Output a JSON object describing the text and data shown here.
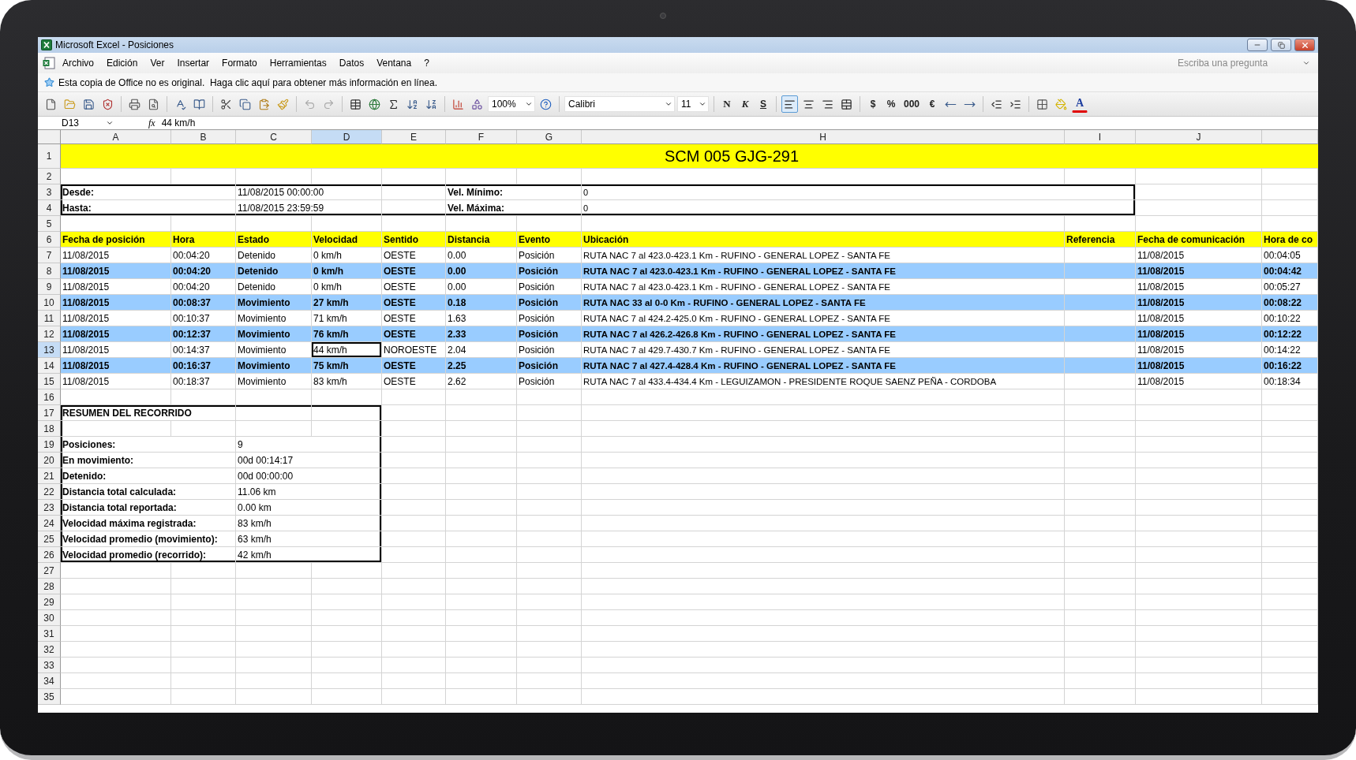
{
  "window": {
    "title": "Microsoft Excel - Posiciones"
  },
  "menu": [
    {
      "label": "Archivo"
    },
    {
      "label": "Edición"
    },
    {
      "label": "Ver"
    },
    {
      "label": "Insertar"
    },
    {
      "label": "Formato"
    },
    {
      "label": "Herramientas"
    },
    {
      "label": "Datos"
    },
    {
      "label": "Ventana"
    },
    {
      "label": "?"
    }
  ],
  "help_search": {
    "placeholder": "Escriba una pregunta"
  },
  "info_bar": {
    "text": "Esta copia de Office no es original.  Haga clic aquí para obtener más información en línea."
  },
  "toolbar": {
    "zoom": "100%",
    "font": "Calibri",
    "size": "11",
    "format_buttons": [
      {
        "label": "N",
        "kind": "bold"
      },
      {
        "label": "K",
        "kind": "italic"
      },
      {
        "label": "S",
        "kind": "underline"
      }
    ],
    "alignment": [
      {
        "kind": "left",
        "selected": true
      },
      {
        "kind": "center",
        "selected": false
      },
      {
        "kind": "right",
        "selected": false
      },
      {
        "kind": "merge",
        "selected": false
      }
    ],
    "number_buttons": [
      {
        "label": "$"
      },
      {
        "label": "%"
      },
      {
        "label": "000"
      },
      {
        "label": "€"
      }
    ],
    "font_color": {
      "label": "A"
    }
  },
  "formula_bar": {
    "name_box": "D13",
    "fx": "fx",
    "value": "44 km/h"
  },
  "columns": [
    {
      "label": "A",
      "selected": false
    },
    {
      "label": "B",
      "selected": false
    },
    {
      "label": "C",
      "selected": false
    },
    {
      "label": "D",
      "selected": true
    },
    {
      "label": "E",
      "selected": false
    },
    {
      "label": "F",
      "selected": false
    },
    {
      "label": "G",
      "selected": false
    },
    {
      "label": "H",
      "selected": false
    },
    {
      "label": "I",
      "selected": false
    },
    {
      "label": "J",
      "selected": false
    }
  ],
  "row_headers": [
    {
      "label": "1",
      "selected": false
    },
    {
      "label": "2",
      "selected": false
    },
    {
      "label": "3",
      "selected": false
    },
    {
      "label": "4",
      "selected": false
    },
    {
      "label": "5",
      "selected": false
    },
    {
      "label": "6",
      "selected": false
    },
    {
      "label": "7",
      "selected": false
    },
    {
      "label": "8",
      "selected": false
    },
    {
      "label": "9",
      "selected": false
    },
    {
      "label": "10",
      "selected": false
    },
    {
      "label": "11",
      "selected": false
    },
    {
      "label": "12",
      "selected": false
    },
    {
      "label": "13",
      "selected": true
    },
    {
      "label": "14",
      "selected": false
    },
    {
      "label": "15",
      "selected": false
    },
    {
      "label": "16",
      "selected": false
    },
    {
      "label": "17",
      "selected": false
    },
    {
      "label": "18",
      "selected": false
    },
    {
      "label": "19",
      "selected": false
    },
    {
      "label": "20",
      "selected": false
    },
    {
      "label": "21",
      "selected": false
    },
    {
      "label": "22",
      "selected": false
    },
    {
      "label": "23",
      "selected": false
    },
    {
      "label": "24",
      "selected": false
    },
    {
      "label": "25",
      "selected": false
    },
    {
      "label": "26",
      "selected": false
    },
    {
      "label": "27",
      "selected": false
    },
    {
      "label": "28",
      "selected": false
    },
    {
      "label": "29",
      "selected": false
    },
    {
      "label": "30",
      "selected": false
    },
    {
      "label": "31",
      "selected": false
    },
    {
      "label": "32",
      "selected": false
    },
    {
      "label": "33",
      "selected": false
    },
    {
      "label": "34",
      "selected": false
    },
    {
      "label": "35",
      "selected": false
    }
  ],
  "sheet": {
    "title": "SCM 005 GJG-291",
    "period": {
      "from_label": "Desde:",
      "from_value": "11/08/2015 00:00:00",
      "to_label": "Hasta:",
      "to_value": "11/08/2015 23:59:59",
      "min_label": "Vel. Mínimo:",
      "min_value": "0",
      "max_label": "Vel. Máxima:",
      "max_value": "0"
    },
    "headers": [
      "Fecha de posición",
      "Hora",
      "Estado",
      "Velocidad",
      "Sentido",
      "Distancia",
      "Evento",
      "Ubicación",
      "Referencia",
      "Fecha de comunicación",
      "Hora de co"
    ],
    "rows": [
      {
        "highlighted": false,
        "date": "11/08/2015",
        "time": "00:04:20",
        "status": "Detenido",
        "speed": "0 km/h",
        "direction": "OESTE",
        "distance": "0.00",
        "event": "Posición",
        "location": "RUTA NAC 7 al 423.0-423.1 Km - RUFINO - GENERAL LOPEZ - SANTA FE",
        "comm_date": "11/08/2015",
        "comm_time": "00:04:05"
      },
      {
        "highlighted": true,
        "date": "11/08/2015",
        "time": "00:04:20",
        "status": "Detenido",
        "speed": "0 km/h",
        "direction": "OESTE",
        "distance": "0.00",
        "event": "Posición",
        "location": "RUTA NAC 7 al 423.0-423.1 Km - RUFINO - GENERAL LOPEZ - SANTA FE",
        "comm_date": "11/08/2015",
        "comm_time": "00:04:42"
      },
      {
        "highlighted": false,
        "date": "11/08/2015",
        "time": "00:04:20",
        "status": "Detenido",
        "speed": "0 km/h",
        "direction": "OESTE",
        "distance": "0.00",
        "event": "Posición",
        "location": "RUTA NAC 7 al 423.0-423.1 Km - RUFINO - GENERAL LOPEZ - SANTA FE",
        "comm_date": "11/08/2015",
        "comm_time": "00:05:27"
      },
      {
        "highlighted": true,
        "date": "11/08/2015",
        "time": "00:08:37",
        "status": "Movimiento",
        "speed": "27 km/h",
        "direction": "OESTE",
        "distance": "0.18",
        "event": "Posición",
        "location": "RUTA NAC 33 al 0-0 Km - RUFINO - GENERAL LOPEZ - SANTA FE",
        "comm_date": "11/08/2015",
        "comm_time": "00:08:22"
      },
      {
        "highlighted": false,
        "date": "11/08/2015",
        "time": "00:10:37",
        "status": "Movimiento",
        "speed": "71 km/h",
        "direction": "OESTE",
        "distance": "1.63",
        "event": "Posición",
        "location": "RUTA NAC 7 al 424.2-425.0 Km - RUFINO - GENERAL LOPEZ - SANTA FE",
        "comm_date": "11/08/2015",
        "comm_time": "00:10:22"
      },
      {
        "highlighted": true,
        "date": "11/08/2015",
        "time": "00:12:37",
        "status": "Movimiento",
        "speed": "76 km/h",
        "direction": "OESTE",
        "distance": "2.33",
        "event": "Posición",
        "location": "RUTA NAC 7 al 426.2-426.8 Km - RUFINO - GENERAL LOPEZ - SANTA FE",
        "comm_date": "11/08/2015",
        "comm_time": "00:12:22"
      },
      {
        "highlighted": false,
        "date": "11/08/2015",
        "time": "00:14:37",
        "status": "Movimiento",
        "speed": "44 km/h",
        "direction": "NOROESTE",
        "distance": "2.04",
        "event": "Posición",
        "location": "RUTA NAC 7 al 429.7-430.7 Km - RUFINO - GENERAL LOPEZ - SANTA FE",
        "comm_date": "11/08/2015",
        "comm_time": "00:14:22"
      },
      {
        "highlighted": true,
        "date": "11/08/2015",
        "time": "00:16:37",
        "status": "Movimiento",
        "speed": "75 km/h",
        "direction": "OESTE",
        "distance": "2.25",
        "event": "Posición",
        "location": "RUTA NAC 7 al 427.4-428.4 Km - RUFINO - GENERAL LOPEZ - SANTA FE",
        "comm_date": "11/08/2015",
        "comm_time": "00:16:22"
      },
      {
        "highlighted": false,
        "date": "11/08/2015",
        "time": "00:18:37",
        "status": "Movimiento",
        "speed": "83 km/h",
        "direction": "OESTE",
        "distance": "2.62",
        "event": "Posición",
        "location": "RUTA NAC 7 al 433.4-434.4 Km - LEGUIZAMON - PRESIDENTE ROQUE SAENZ PEÑA - CORDOBA",
        "comm_date": "11/08/2015",
        "comm_time": "00:18:34"
      }
    ],
    "summary": {
      "title": "RESUMEN DEL RECORRIDO",
      "items": [
        {
          "label": "Posiciones:",
          "value": "9"
        },
        {
          "label": "En movimiento:",
          "value": "00d 00:14:17"
        },
        {
          "label": "Detenido:",
          "value": "00d 00:00:00"
        },
        {
          "label": "Distancia total calculada:",
          "value": "11.06 km"
        },
        {
          "label": "Distancia total reportada:",
          "value": "0.00 km"
        },
        {
          "label": "Velocidad máxima registrada:",
          "value": "83 km/h"
        },
        {
          "label": "Velocidad promedio (movimiento):",
          "value": "63 km/h"
        },
        {
          "label": "Velocidad promedio (recorrido):",
          "value": "42 km/h"
        }
      ]
    }
  }
}
